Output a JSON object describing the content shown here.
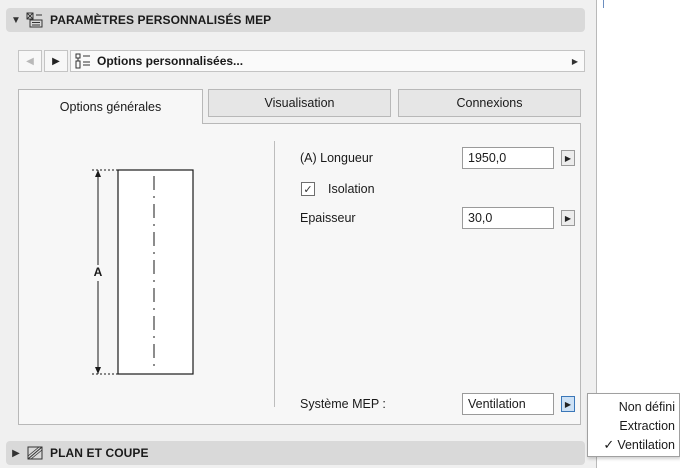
{
  "section_mep": {
    "title": "PARAMÈTRES PERSONNALISÉS MEP",
    "icon": "mep-settings-icon"
  },
  "nav": {
    "back_icon": "chevron-left-icon",
    "forward_icon": "chevron-right-icon",
    "preset_label": "Options personnalisées...",
    "preset_icon": "custom-options-icon"
  },
  "tabs": [
    {
      "label": "Options générales",
      "active": true
    },
    {
      "label": "Visualisation",
      "active": false
    },
    {
      "label": "Connexions",
      "active": false
    }
  ],
  "diagram": {
    "dimension_label": "A"
  },
  "fields": {
    "length_label": "(A) Longueur",
    "length_value": "1950,0",
    "insulation_label": "Isolation",
    "insulation_checked": true,
    "thickness_label": "Epaisseur",
    "thickness_value": "30,0",
    "system_label": "Système MEP :",
    "system_value": "Ventilation"
  },
  "system_menu": {
    "options": [
      "Non défini",
      "Extraction",
      "Ventilation"
    ],
    "selected": "Ventilation"
  },
  "section_plan": {
    "title": "PLAN ET COUPE",
    "icon": "plan-section-icon"
  },
  "colors": {
    "header_bg": "#d9d9d9",
    "panel_bg": "#f0f0f0",
    "accent": "#3b77b8"
  }
}
